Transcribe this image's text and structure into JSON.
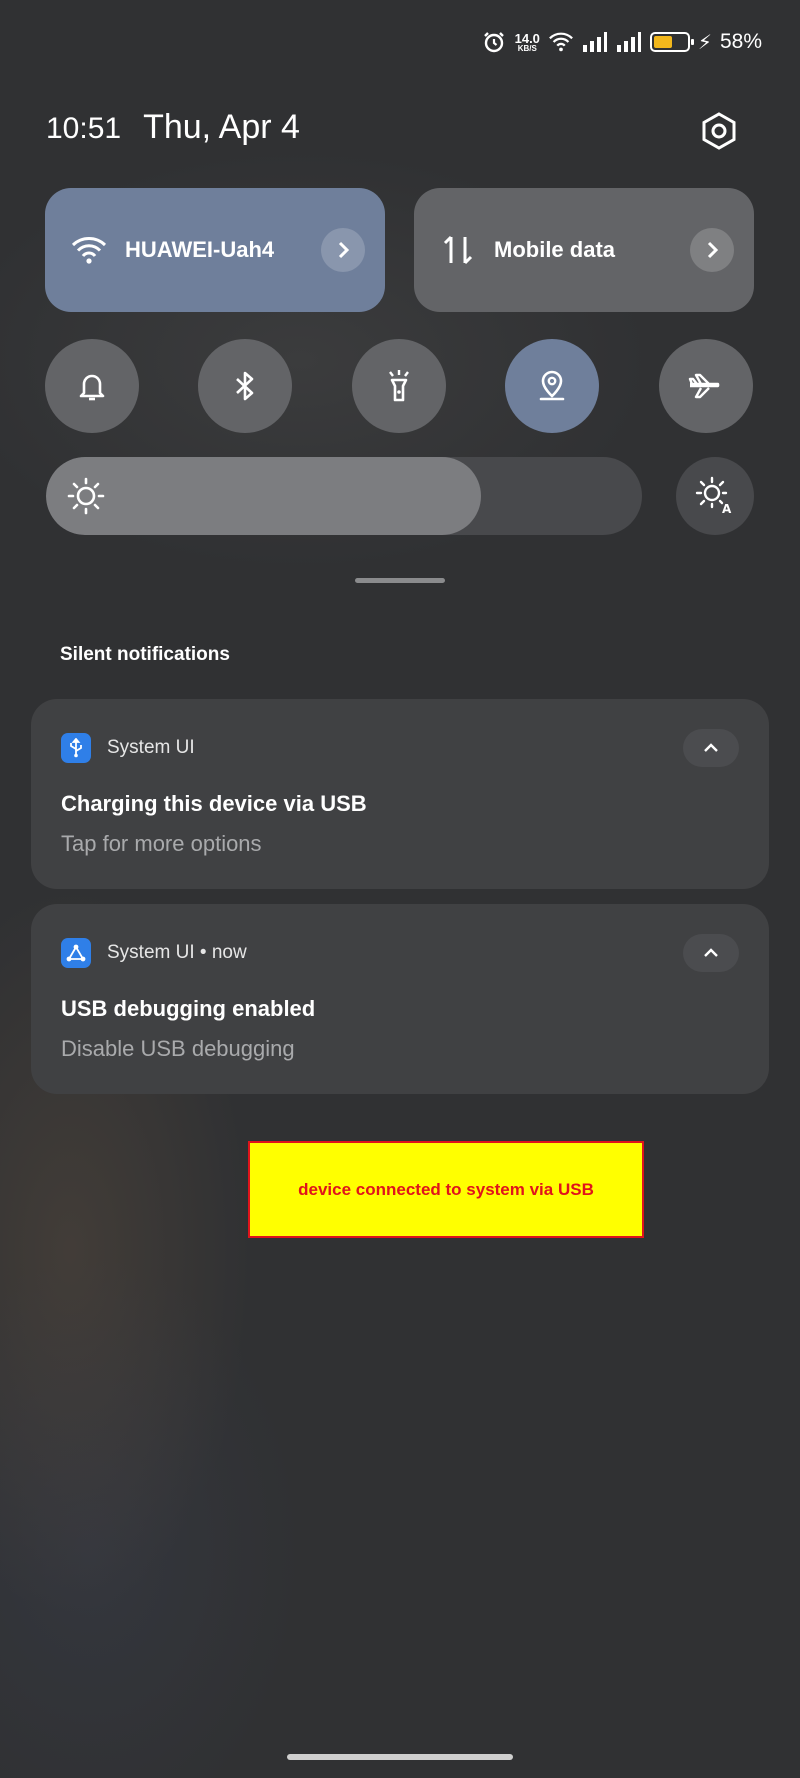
{
  "status_bar": {
    "net_speed_value": "14.0",
    "net_speed_unit": "KB/S",
    "battery_percent": "58%",
    "battery_level": 0.58,
    "icons": [
      "alarm-icon",
      "wifi-icon",
      "signal-icon",
      "signal-icon",
      "battery-icon",
      "charging-icon"
    ]
  },
  "header": {
    "time": "10:51",
    "date": "Thu, Apr 4"
  },
  "quick_tiles": {
    "wifi": {
      "label": "HUAWEI-Uah4",
      "active": true
    },
    "mobile_data": {
      "label": "Mobile data",
      "active": false
    }
  },
  "toggles": [
    {
      "name": "sound",
      "icon": "bell-icon",
      "active": false
    },
    {
      "name": "bluetooth",
      "icon": "bluetooth-icon",
      "active": false
    },
    {
      "name": "flashlight",
      "icon": "flashlight-icon",
      "active": false
    },
    {
      "name": "location",
      "icon": "location-icon",
      "active": true
    },
    {
      "name": "airplane",
      "icon": "airplane-icon",
      "active": false
    }
  ],
  "brightness": {
    "level": 0.73
  },
  "section_title": "Silent notifications",
  "notifications": [
    {
      "app": "System UI",
      "title": "Charging this device via USB",
      "text": "Tap for more options",
      "icon": "usb-icon"
    },
    {
      "app": "System UI • now",
      "title": "USB debugging enabled",
      "text": "Disable USB debugging",
      "icon": "debug-icon"
    }
  ],
  "annotation": "device connected to system via USB",
  "colors": {
    "accent_tile": "#6f7f9b",
    "inactive_tile": "#636467",
    "battery_fill": "#f2b71c",
    "app_icon": "#2f7fe8",
    "annotation_bg": "#ffff00",
    "annotation_text": "#e0141b"
  }
}
